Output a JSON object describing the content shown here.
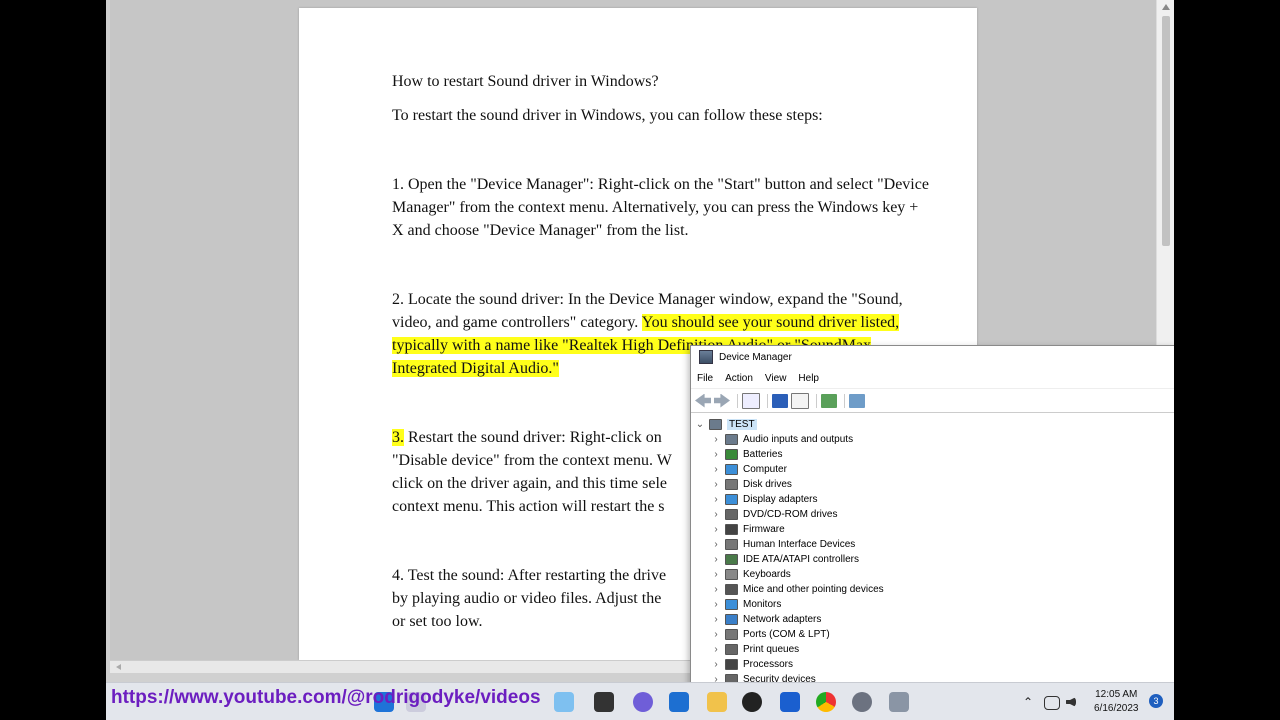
{
  "document": {
    "title": "How to restart Sound driver in Windows?",
    "intro": "To restart the sound driver in Windows, you can follow these steps:",
    "step1": "1. Open the \"Device Manager\": Right-click on the \"Start\" button and select \"Device Manager\" from the context menu. Alternatively, you can press the Windows key + X and choose \"Device Manager\" from the list.",
    "step2_plain": "2. Locate the sound driver: In the Device Manager window, expand the \"Sound, video, and game controllers\" category. ",
    "step2_highlight": "You should see your sound driver listed, typically with a name like \"Realtek High Definition Audio\" or \"SoundMax Integrated Digital Audio.\"",
    "step3_number": "3.",
    "step3_text": " Restart the sound driver: Right-click on",
    "step3_line2": "\"Disable device\" from the context menu. W",
    "step3_line3": "click on the driver again, and this time sele",
    "step3_line4": "context menu. This action will restart the s",
    "step4_line1": "4. Test the sound: After restarting the drive",
    "step4_line2": "by playing audio or video files. Adjust the",
    "step4_line3": "or set too low."
  },
  "device_manager": {
    "title": "Device Manager",
    "menu": [
      "File",
      "Action",
      "View",
      "Help"
    ],
    "root": "TEST",
    "items": [
      {
        "label": "Audio inputs and outputs",
        "icon": "speaker-icon",
        "color": "#6b7b8c"
      },
      {
        "label": "Batteries",
        "icon": "battery-icon",
        "color": "#3a8a3a"
      },
      {
        "label": "Computer",
        "icon": "computer-icon",
        "color": "#3c8fd8"
      },
      {
        "label": "Disk drives",
        "icon": "disk-icon",
        "color": "#777777"
      },
      {
        "label": "Display adapters",
        "icon": "display-icon",
        "color": "#3c8fd8"
      },
      {
        "label": "DVD/CD-ROM drives",
        "icon": "dvd-icon",
        "color": "#666666"
      },
      {
        "label": "Firmware",
        "icon": "firmware-icon",
        "color": "#444444"
      },
      {
        "label": "Human Interface Devices",
        "icon": "hid-icon",
        "color": "#777777"
      },
      {
        "label": "IDE ATA/ATAPI controllers",
        "icon": "ide-icon",
        "color": "#4a7a4a"
      },
      {
        "label": "Keyboards",
        "icon": "keyboard-icon",
        "color": "#888888"
      },
      {
        "label": "Mice and other pointing devices",
        "icon": "mouse-icon",
        "color": "#555555"
      },
      {
        "label": "Monitors",
        "icon": "monitor-icon",
        "color": "#3c8fd8"
      },
      {
        "label": "Network adapters",
        "icon": "network-icon",
        "color": "#3a7fc8"
      },
      {
        "label": "Ports (COM & LPT)",
        "icon": "port-icon",
        "color": "#777777"
      },
      {
        "label": "Print queues",
        "icon": "printer-icon",
        "color": "#666666"
      },
      {
        "label": "Processors",
        "icon": "processor-icon",
        "color": "#444444"
      },
      {
        "label": "Security devices",
        "icon": "security-icon",
        "color": "#666666"
      }
    ]
  },
  "overlay": {
    "url": "https://www.youtube.com/@rodrigodyke/videos"
  },
  "taskbar": {
    "time": "12:05 AM",
    "date": "6/16/2023",
    "notification_count": "3"
  }
}
